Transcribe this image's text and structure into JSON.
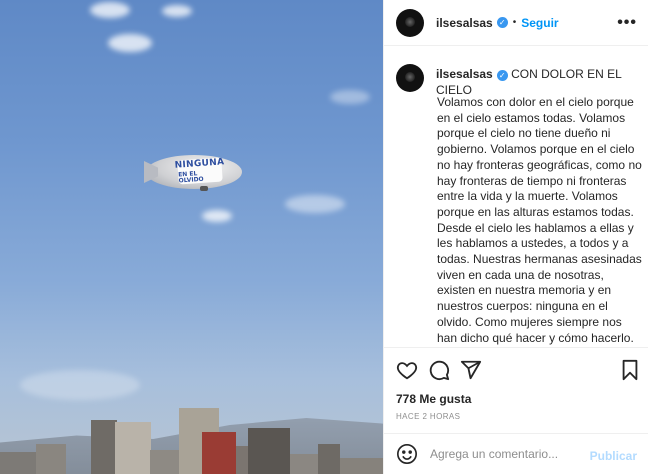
{
  "photo": {
    "banner_line1": "NINGUNA",
    "banner_line2": "EN EL OLVIDO"
  },
  "header": {
    "username": "ilsesalsas",
    "separator": "•",
    "follow_label": "Seguir",
    "more_icon": "more-horizontal-icon"
  },
  "caption": {
    "username": "ilsesalsas",
    "title": "CON DOLOR EN EL CIELO",
    "body": "Volamos con dolor en el cielo porque en el cielo estamos todas. Volamos porque el cielo no tiene dueño ni gobierno. Volamos porque en el cielo no hay fronteras geográficas, como no hay fronteras de tiempo ni fronteras entre la vida y la muerte. Volamos porque en las alturas estamos todas. Desde el cielo les hablamos a ellas y les hablamos a ustedes, a todos y a todas. Nuestras hermanas asesinadas viven en cada una de nosotras, existen en nuestra memoria y en nuestros cuerpos: ninguna en el olvido. Como mujeres siempre nos han dicho qué hacer y cómo hacerlo. Nos dijeron también qué no hacer y cómo no hacer lo que no nos corresponde."
  },
  "stats": {
    "likes": "778 Me gusta",
    "time": "HACE 2 HORAS"
  },
  "comment": {
    "placeholder": "Agrega un comentario...",
    "publish_label": "Publicar"
  },
  "colors": {
    "accent": "#0095f6",
    "verified": "#3897f0",
    "publish_disabled": "#b3dbff"
  }
}
